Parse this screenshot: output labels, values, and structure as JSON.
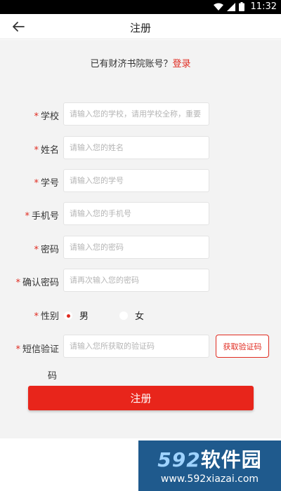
{
  "status_bar": {
    "time": "11:32"
  },
  "header": {
    "title": "注册"
  },
  "login_hint": {
    "text": "已有财济书院账号？",
    "link": "登录"
  },
  "required_mark": "*",
  "form": {
    "school": {
      "label": "学校",
      "placeholder": "请输入您的学校，请用学校全称，重要"
    },
    "name": {
      "label": "姓名",
      "placeholder": "请输入您的姓名"
    },
    "student_id": {
      "label": "学号",
      "placeholder": "请输入您的学号"
    },
    "phone": {
      "label": "手机号",
      "placeholder": "请输入您的手机号"
    },
    "password": {
      "label": "密码",
      "placeholder": "请输入您的密码"
    },
    "confirm_password": {
      "label": "确认密码",
      "placeholder": "请再次输入您的密码"
    },
    "gender": {
      "label": "性别",
      "options": [
        "男",
        "女"
      ],
      "selected": "男"
    },
    "sms_code": {
      "label_line1": "短信验证",
      "label_line2": "码",
      "placeholder": "请输入您所获取的验证码",
      "button": "获取验证码"
    }
  },
  "submit": {
    "label": "注册"
  },
  "watermark": {
    "brand_num": "592",
    "brand_text": "软件园",
    "url": "www.592xiazai.com"
  },
  "colors": {
    "accent": "#e02b20",
    "background": "#f3f3f3",
    "watermark_bg": "#1f5a8d"
  }
}
